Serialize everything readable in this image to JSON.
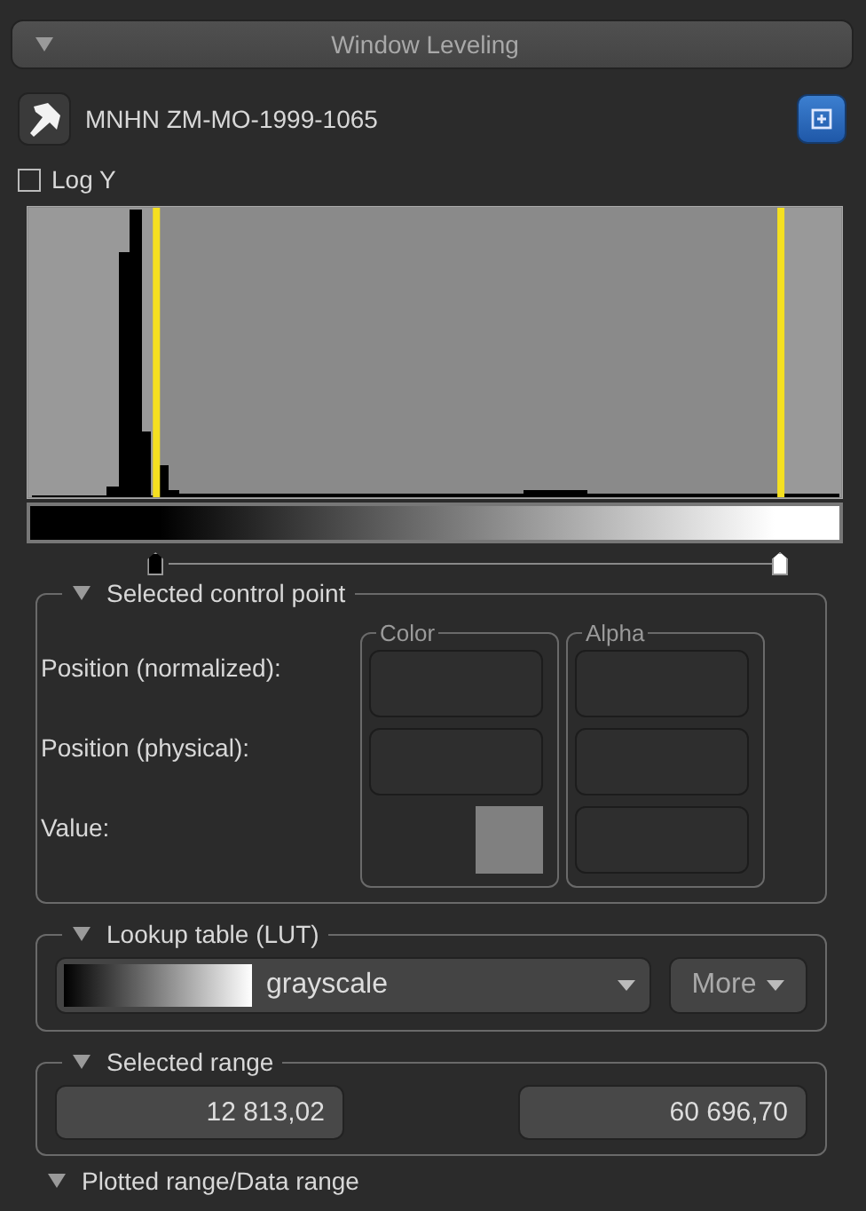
{
  "panel": {
    "title": "Window Leveling",
    "expanded": true
  },
  "dataset": {
    "name": "MNHN ZM-MO-1999-1065"
  },
  "log_y": {
    "label": "Log Y",
    "checked": false
  },
  "control_points": [
    {
      "level": 0.159
    },
    {
      "level": 0.924
    }
  ],
  "selected_control_point": {
    "title": "Selected control point",
    "expanded": true,
    "labels": [
      "Position (normalized):",
      "Position (physical):",
      "Value:"
    ],
    "color_group": "Color",
    "alpha_group": "Alpha"
  },
  "lookup_table": {
    "title": "Lookup table (LUT)",
    "expanded": true,
    "value": "grayscale",
    "more_button": "More"
  },
  "selected_range": {
    "title": "Selected range",
    "expanded": true,
    "min": "12 813,02",
    "max": "60 696,70"
  },
  "next_section": {
    "title": "Plotted range/Data range",
    "expanded": true
  }
}
